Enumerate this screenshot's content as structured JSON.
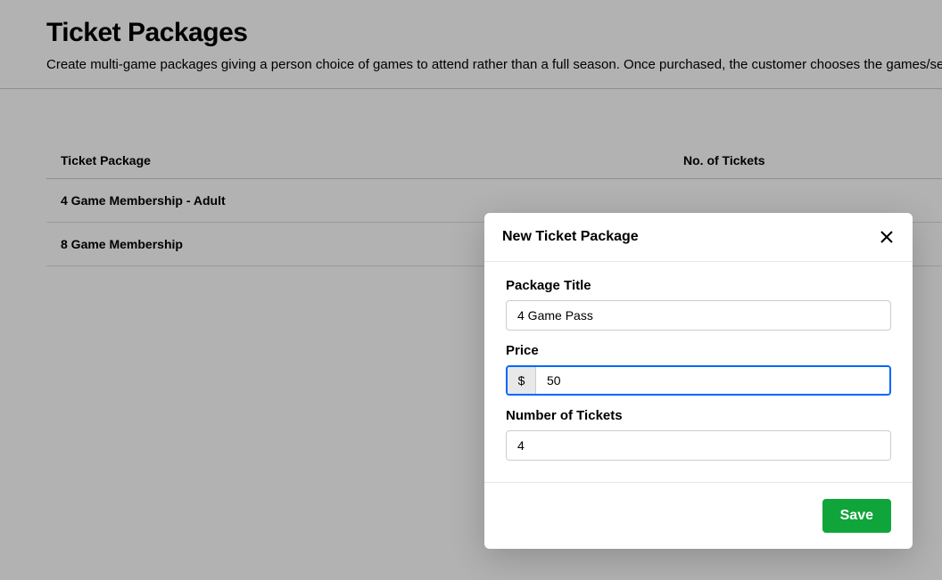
{
  "header": {
    "title": "Ticket Packages",
    "subtitle": "Create multi-game packages giving a person choice of games to attend rather than a full season. Once purchased, the customer chooses the games/seats t"
  },
  "table": {
    "columns": {
      "name": "Ticket Package",
      "tickets": "No. of Tickets"
    },
    "rows": [
      {
        "name": "4 Game Membership - Adult"
      },
      {
        "name": "8 Game Membership"
      }
    ]
  },
  "modal": {
    "title": "New Ticket Package",
    "fields": {
      "package_title": {
        "label": "Package Title",
        "value": "4 Game Pass"
      },
      "price": {
        "label": "Price",
        "currency": "$",
        "value": "50"
      },
      "num_tickets": {
        "label": "Number of Tickets",
        "value": "4"
      }
    },
    "save_label": "Save"
  }
}
